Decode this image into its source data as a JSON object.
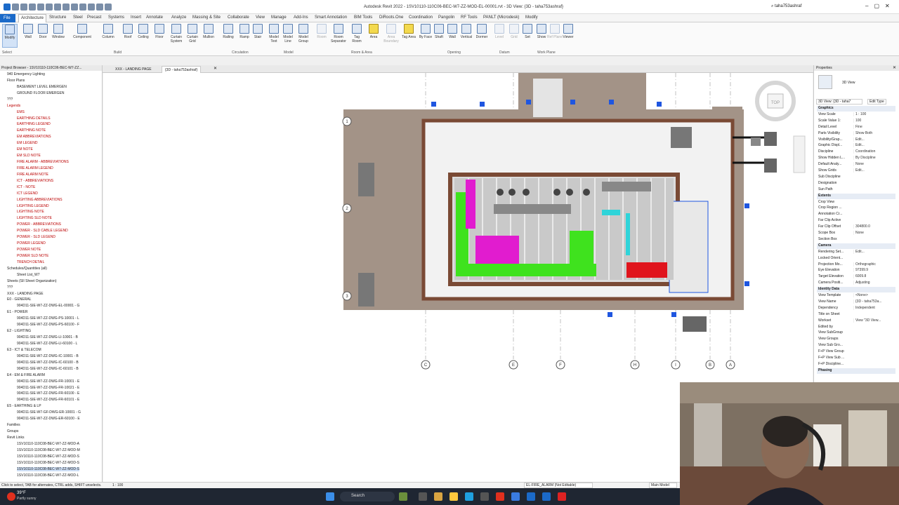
{
  "window": {
    "title": "Autodesk Revit 2022 - 1SV10110-110C06-BEC-W7-ZZ-MOD-EL-00001.rvt - 3D View: {3D - taha753ashraf}",
    "user": "taha753ashraf"
  },
  "tabs": [
    "File",
    "Architecture",
    "Structure",
    "Steel",
    "Precast",
    "Systems",
    "Insert",
    "Annotate",
    "Analyze",
    "Massing & Site",
    "Collaborate",
    "View",
    "Manage",
    "Add-Ins",
    "Smart Annotation",
    "BIM Tools",
    "DiRoots.One",
    "Coordination",
    "Pangolin",
    "RF Tools",
    "PANLT (Microdesk)",
    "Modify"
  ],
  "ribbon": {
    "buttons": [
      "Modify",
      "Wall",
      "Door",
      "Window",
      "Component",
      "Column",
      "Roof",
      "Ceiling",
      "Floor",
      "Curtain System",
      "Curtain Grid",
      "Mullion",
      "Railing",
      "Ramp",
      "Stair",
      "Model Text",
      "Model Line",
      "Model Group",
      "Room",
      "Room Separator",
      "Tag Room",
      "Area",
      "Area Boundary",
      "Tag Area",
      "By Face",
      "Shaft",
      "Wall",
      "Vertical",
      "Dormer",
      "Level",
      "Grid",
      "Set",
      "Show",
      "Ref Plane",
      "Viewer"
    ],
    "groups": [
      "Select",
      "Build",
      "Circulation",
      "Model",
      "Room & Area",
      "Opening",
      "Datum",
      "Work Plane"
    ]
  },
  "doc_tabs": [
    "XXX - LANDING PAGE",
    "{3D - taha753ashraf}"
  ],
  "project_browser": {
    "title": "Project Browser - 1SV10110-110C06-BEC-W7-ZZ...",
    "nodes": [
      "940 Emergency Lighting",
      "Floor Plans",
      "BASEMENT LEVEL EMERGEN",
      "GROUND FLOOR EMERGEN",
      "???",
      "Legends",
      "EMS",
      "EARTHING DETAILS",
      "EARTHING LEGEND",
      "EARTHING NOTE",
      "EM ABBREVIATIONS",
      "EM LEGEND",
      "EM NOTE",
      "EM SLD NOTE",
      "FIRE ALARM - ABBREVIATIONS",
      "FIRE ALARM LEGEND",
      "FIRE ALARM NOTE",
      "ICT - ABBREVIATIONS",
      "ICT - NOTE",
      "ICT LEGEND",
      "LIGHTING ABBREVIATIONS",
      "LIGHTING LEGEND",
      "LIGHTING NOTE",
      "LIGHTING SLD NOTE",
      "POWER - ABBREVIATIONS",
      "POWER - SLD CABLE LEGEND",
      "POWER - SLD LEGEND",
      "POWER LEGEND",
      "POWER NOTE",
      "POWER SLD NOTE",
      "TRENCH DETAIL",
      "Schedules/Quantities (all)",
      "Sheet List_W7",
      "Sheets (SII Sheet Organization)",
      "???",
      "XXX - LANDING PAGE",
      "E0 - GENERAL",
      "904D11-SIE-W7-ZZ-DWG-EL-00001 - G",
      "E1 - POWER",
      "904D11-SIE-W7-ZZ-DWG-PS-10001 - L",
      "904D11-SIE-W7-ZZ-DWG-PS-60100 - F",
      "E2 - LIGHTING",
      "904D11-SIE-W7-ZZ-DWG-LI-10001 - B",
      "904D11-SIE-W7-ZZ-DWG-LI-60100 - L",
      "E3 - ICT & TELECOM",
      "904D11-SIE-W7-ZZ-DWG-IC-10001 - B",
      "904D11-SIE-W7-ZZ-DWG-IC-60100 - B",
      "904D11-SIE-W7-ZZ-DWG-IC-60101 - B",
      "E4 - EM & FIRE ALARM",
      "904D11-SIE-W7-ZZ-DWG-FR-10001 - E",
      "904D11-SIE-W7-ZZ-DWG-FR-10021 - E",
      "904D11-SIE-W7-ZZ-DWG-FR-60100 - E",
      "904D11-SIE-W7-ZZ-DWG-FR-60101 - E",
      "E5 - EARTHING & LP",
      "904D11-SIE-W7-GF-DWG-ER-10001 - G",
      "904D11-SIE-W7-ZZ-DWG-ER-60100 - E",
      "Families",
      "Groups",
      "Revit Links",
      "1SV10110-110C08-BEC-W7-ZZ-MOD-A",
      "1SV10110-110C08-BEC-W7-ZZ-MOD-M",
      "1SV10110-110C08-BEC-W7-ZZ-MOD-S",
      "1SV10110-110C08-BEC-W7-ZZ-MOD-S",
      "1SV10110-110C08-BEC-W7-ZZ-MOD-S",
      "1SV10110-110C08-BEC-W7-ZZ-MOD-L"
    ]
  },
  "properties": {
    "title": "Properties",
    "type": "3D View",
    "selector": "3D View: {3D - taha7",
    "edit_type": "Edit Type",
    "rows": [
      {
        "k": "Graphics",
        "v": "",
        "cat": true
      },
      {
        "k": "View Scale",
        "v": "1 : 100"
      },
      {
        "k": "Scale Value  1:",
        "v": "100"
      },
      {
        "k": "Detail Level",
        "v": "Fine"
      },
      {
        "k": "Parts Visibility",
        "v": "Show Both"
      },
      {
        "k": "Visibility/Grap...",
        "v": "Edit..."
      },
      {
        "k": "Graphic Displ...",
        "v": "Edit..."
      },
      {
        "k": "Discipline",
        "v": "Coordination"
      },
      {
        "k": "Show Hidden L...",
        "v": "By Discipline"
      },
      {
        "k": "Default Analy...",
        "v": "None"
      },
      {
        "k": "Show Grids",
        "v": "Edit..."
      },
      {
        "k": "Sub Discipline",
        "v": ""
      },
      {
        "k": "Designation",
        "v": ""
      },
      {
        "k": "Sun Path",
        "v": ""
      },
      {
        "k": "Extents",
        "v": "",
        "cat": true
      },
      {
        "k": "Crop View",
        "v": ""
      },
      {
        "k": "Crop Region ...",
        "v": ""
      },
      {
        "k": "Annotation Cr...",
        "v": ""
      },
      {
        "k": "Far Clip Active",
        "v": ""
      },
      {
        "k": "Far Clip Offset",
        "v": "304800.0"
      },
      {
        "k": "Scope Box",
        "v": "None"
      },
      {
        "k": "Section Box",
        "v": ""
      },
      {
        "k": "Camera",
        "v": "",
        "cat": true
      },
      {
        "k": "Rendering Set...",
        "v": "Edit..."
      },
      {
        "k": "Locked Orient...",
        "v": ""
      },
      {
        "k": "Projection Mo...",
        "v": "Orthographic"
      },
      {
        "k": "Eye Elevation",
        "v": "97399.9"
      },
      {
        "k": "Target Elevation",
        "v": "6009.8"
      },
      {
        "k": "Camera Positi...",
        "v": "Adjusting"
      },
      {
        "k": "Identity Data",
        "v": "",
        "cat": true
      },
      {
        "k": "View Template",
        "v": "<None>"
      },
      {
        "k": "View Name",
        "v": "{3D - taha753a..."
      },
      {
        "k": "Dependency",
        "v": "Independent"
      },
      {
        "k": "Title on Sheet",
        "v": ""
      },
      {
        "k": "Workset",
        "v": "View \"3D View..."
      },
      {
        "k": "Edited by",
        "v": ""
      },
      {
        "k": "View SubGroup",
        "v": ""
      },
      {
        "k": "View Groups",
        "v": ""
      },
      {
        "k": "View Sub Gro...",
        "v": ""
      },
      {
        "k": "F+P View Group",
        "v": ""
      },
      {
        "k": "F+P View Sub ...",
        "v": ""
      },
      {
        "k": "F+P Discipline...",
        "v": ""
      },
      {
        "k": "Phasing",
        "v": "",
        "cat": true
      }
    ]
  },
  "status": {
    "hint": "Click to select, TAB for alternates, CTRL adds, SHIFT unselects.",
    "workset": "EL-FIRE_ALARM (Not Editable)",
    "model": "Main Model",
    "scale": "1 : 100"
  },
  "grids": [
    "1",
    "2",
    "3",
    "C",
    "E",
    "F",
    "H",
    "I",
    "B",
    "A"
  ],
  "taskbar": {
    "search": "Search",
    "weather": "39°F",
    "weather_note": "Partly sunny"
  },
  "colors": {
    "accent": "#1b6ac9",
    "wall": "#7a4a35",
    "slab": "#a39387",
    "magenta": "#e11ccf",
    "green": "#3fe21e",
    "cyan": "#2fd4d9",
    "red": "#e0141c",
    "marker": "#1f56e0"
  }
}
